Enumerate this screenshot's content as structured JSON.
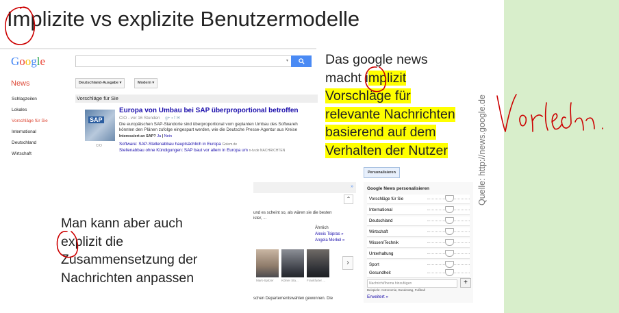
{
  "slide": {
    "title": "Implizite vs explizite Benutzermodelle",
    "right_text": {
      "l1": "Das google news",
      "l2a": "macht i",
      "l2b": "mplizit",
      "l3": "Vorschläge für",
      "l4": "relevante Nachrichten",
      "l5": "basierend auf dem",
      "l6": "Verhalten der Nutzer"
    },
    "left_text": {
      "l1": "Man kann aber auch",
      "l2": "explizit die",
      "l3": "Zusammensetzung der",
      "l4": "Nachrichten anpassen"
    },
    "source": "Quelle: http://news.google.de",
    "handwriting": "Vorlesen"
  },
  "colors": {
    "highlight": "#ffff00",
    "ink": "#cc0000",
    "panel": "#d8eecb",
    "google_blue": "#4a8af4"
  },
  "news1": {
    "logo": "Google",
    "search_button_icon": "search-icon",
    "news_label": "News",
    "edition": "Deutschland-Ausgabe",
    "modern": "Modern",
    "sidebar": [
      "Schlagzeilen",
      "Lokales",
      "Vorschläge für Sie",
      "International",
      "Deutschland",
      "Wirtschaft"
    ],
    "section": "Vorschläge für Sie",
    "thumb_label": "CIO",
    "story": {
      "title": "Europa von Umbau bei SAP überproportional betroffen",
      "meta": "CIO - vor 16 Stunden",
      "body1": "Die europäischen SAP-Standorte sind überproportional vom geplanten Umbau des Softwareh",
      "body2": "könnten den Plänen zufolge eingespart werden, wie die Deutsche Presse-Agentur aus Kreise",
      "interest": "Interessiert an SAP?",
      "yes": "Ja",
      "no": "Nein",
      "rel1_link": "Software: SAP-Stellenabbau hauptsächlich in Europa",
      "rel1_src": "Golem.de",
      "rel2_link": "Stellenabbau ohne Kündigungen: SAP baut vor allem in Europa um",
      "rel2_src": "n-tv.de NACHRICHTEN"
    }
  },
  "news2": {
    "header_arrow": "»",
    "up_icon": "chevron-up-icon",
    "line1": "und es scheint so, als wären sie die besten",
    "line2": "ister, ...",
    "similar": "Ähnlich",
    "person1": "Alexis Tsipras »",
    "person2": "Angela Merkel »",
    "captions": [
      "Mark-Spitzer",
      "Kölner Sta...",
      "Frankfurter ..."
    ],
    "next_icon": "chevron-right-icon",
    "footer": "schen Departementswahlen gewonnen. Die"
  },
  "news3": {
    "personalize_button": "Personalisieren",
    "title": "Google News personalisieren",
    "topics": [
      "Vorschläge für Sie",
      "International",
      "Deutschland",
      "Wirtschaft",
      "Wissen/Technik",
      "Unterhaltung",
      "Sport",
      "Gesundheit"
    ],
    "input_placeholder": "Nachricht/Ihema hinzufügen",
    "plus": "+",
    "example": "Beispiele: Astronomie, Bundestag, Fußball",
    "more": "Erweitert »"
  }
}
